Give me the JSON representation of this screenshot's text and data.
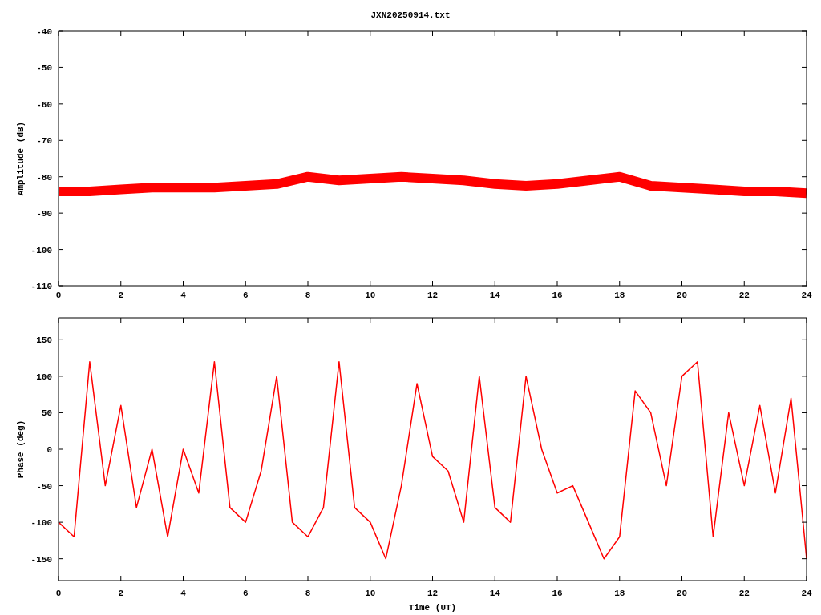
{
  "title": "JXN20250914.txt",
  "amplitude_plot": {
    "chart_data": {
      "type": "line",
      "ylabel": "Amplitude (dB)",
      "x": [
        0,
        1,
        2,
        3,
        4,
        5,
        6,
        7,
        8,
        9,
        10,
        11,
        12,
        13,
        14,
        15,
        16,
        17,
        18,
        19,
        20,
        21,
        22,
        23,
        24
      ],
      "xlim": [
        0,
        24
      ],
      "ylim": [
        -110,
        -40
      ],
      "xticks": [
        0,
        2,
        4,
        6,
        8,
        10,
        12,
        14,
        16,
        18,
        20,
        22,
        24
      ],
      "yticks": [
        -110,
        -100,
        -90,
        -80,
        -70,
        -60,
        -50,
        -40
      ],
      "series": [
        {
          "color": "#ff0000",
          "values": [
            -84,
            -84,
            -83.5,
            -83,
            -83,
            -83,
            -82.5,
            -82,
            -80,
            -81,
            -80.5,
            -80,
            -80.5,
            -81,
            -82,
            -82.5,
            -82,
            -81,
            -80,
            -82.5,
            -83,
            -83.5,
            -84,
            -84,
            -84.5
          ]
        }
      ]
    }
  },
  "phase_plot": {
    "chart_data": {
      "type": "line",
      "xlabel": "Time (UT)",
      "ylabel": "Phase (deg)",
      "x": [
        0,
        0.5,
        1,
        1.5,
        2,
        2.5,
        3,
        3.5,
        4,
        4.5,
        5,
        5.5,
        6,
        6.5,
        7,
        7.5,
        8,
        8.5,
        9,
        9.5,
        10,
        10.5,
        11,
        11.5,
        12,
        12.5,
        13,
        13.5,
        14,
        14.5,
        15,
        15.5,
        16,
        16.5,
        17,
        17.5,
        18,
        18.5,
        19,
        19.5,
        20,
        20.5,
        21,
        21.5,
        22,
        22.5,
        23,
        23.5,
        24
      ],
      "xlim": [
        0,
        24
      ],
      "ylim": [
        -180,
        180
      ],
      "xticks": [
        0,
        2,
        4,
        6,
        8,
        10,
        12,
        14,
        16,
        18,
        20,
        22,
        24
      ],
      "yticks": [
        -150,
        -100,
        -50,
        0,
        50,
        100,
        150
      ],
      "series": [
        {
          "color": "#ff0000",
          "values": [
            -100,
            -120,
            120,
            -50,
            60,
            -80,
            0,
            -120,
            0,
            -60,
            120,
            -80,
            -100,
            -30,
            100,
            -100,
            -120,
            -80,
            120,
            -80,
            -100,
            -150,
            -50,
            90,
            -10,
            -30,
            -100,
            100,
            -80,
            -100,
            100,
            0,
            -60,
            -50,
            -100,
            -150,
            -120,
            80,
            50,
            -50,
            100,
            120,
            -120,
            50,
            -50,
            60,
            -60,
            70,
            -150
          ]
        }
      ]
    }
  }
}
